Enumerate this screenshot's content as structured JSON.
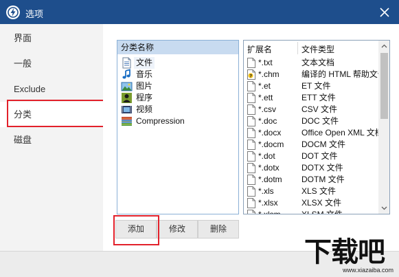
{
  "window": {
    "title": "选项",
    "close_icon": "close-icon",
    "app_icon": "lightning-logo-icon",
    "title_bar_color": "#1e4e8c"
  },
  "sidebar": {
    "items": [
      {
        "label": "界面"
      },
      {
        "label": "一般"
      },
      {
        "label": "Exclude"
      },
      {
        "label": "分类",
        "active": true
      },
      {
        "label": "磁盘"
      }
    ]
  },
  "categories": {
    "header": "分类名称",
    "items": [
      {
        "label": "文件",
        "icon": "document-icon",
        "selected": true
      },
      {
        "label": "音乐",
        "icon": "music-note-icon"
      },
      {
        "label": "图片",
        "icon": "picture-icon"
      },
      {
        "label": "程序",
        "icon": "program-person-icon"
      },
      {
        "label": "视频",
        "icon": "film-icon"
      },
      {
        "label": "Compression",
        "icon": "books-archive-icon"
      }
    ]
  },
  "extensions": {
    "col_ext": "扩展名",
    "col_type": "文件类型",
    "rows": [
      {
        "ext": "*.txt",
        "type": "文本文档"
      },
      {
        "ext": "*.chm",
        "type": "编译的 HTML 帮助文件"
      },
      {
        "ext": "*.et",
        "type": "ET 文件"
      },
      {
        "ext": "*.ett",
        "type": "ETT 文件"
      },
      {
        "ext": "*.csv",
        "type": "CSV 文件"
      },
      {
        "ext": "*.doc",
        "type": "DOC 文件"
      },
      {
        "ext": "*.docx",
        "type": "Office Open XML 文档"
      },
      {
        "ext": "*.docm",
        "type": "DOCM 文件"
      },
      {
        "ext": "*.dot",
        "type": "DOT 文件"
      },
      {
        "ext": "*.dotx",
        "type": "DOTX 文件"
      },
      {
        "ext": "*.dotm",
        "type": "DOTM 文件"
      },
      {
        "ext": "*.xls",
        "type": "XLS 文件"
      },
      {
        "ext": "*.xlsx",
        "type": "XLSX 文件"
      },
      {
        "ext": "*.xlsm",
        "type": "XLSM 文件"
      }
    ]
  },
  "buttons": {
    "add": "添加",
    "edit": "修改",
    "delete": "删除"
  },
  "watermark": {
    "main": "下载吧",
    "url": "www.xiazaiba.com"
  },
  "highlight_color": "#e2202a"
}
